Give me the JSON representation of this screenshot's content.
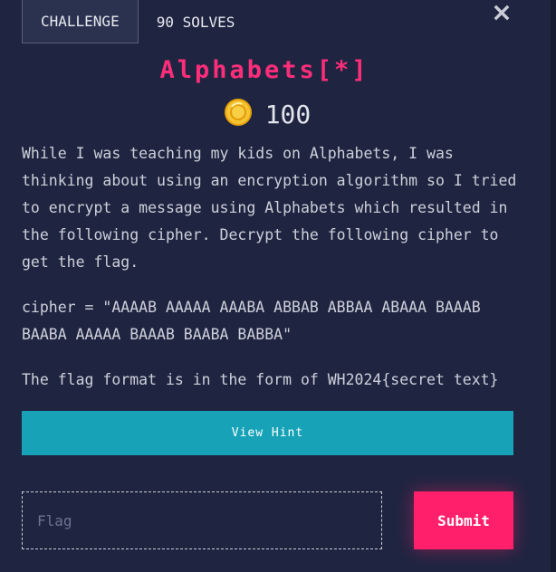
{
  "tabs": [
    {
      "label": "CHALLENGE",
      "active": true
    },
    {
      "label": "90 SOLVES",
      "active": false
    }
  ],
  "challenge": {
    "name": "Alphabets[*]",
    "points": "100",
    "description": "While I was teaching my kids on Alphabets, I was thinking about using an encryption algorithm so I tried to encrypt a message using Alphabets which resulted in the following cipher. Decrypt the following cipher to get the flag.",
    "cipher": "cipher = \"AAAAB AAAAA AAABA ABBAB ABBAA ABAAA BAAAB BAABA AAAAA BAAAB BAABA BABBA\"",
    "flag_format": "The flag format is in the form of WH2024{secret text}"
  },
  "hint_button": {
    "label": "View Hint"
  },
  "flag_input": {
    "placeholder": "Flag",
    "value": ""
  },
  "submit_button": {
    "label": "Submit"
  },
  "icons": {
    "close": "close-icon",
    "coin": "coin-icon"
  },
  "colors": {
    "background": "#1f2541",
    "title": "#ff2d7a",
    "hint_button": "#17a2b8",
    "submit_button": "#ff1f6b",
    "coin": "#f5c531"
  }
}
